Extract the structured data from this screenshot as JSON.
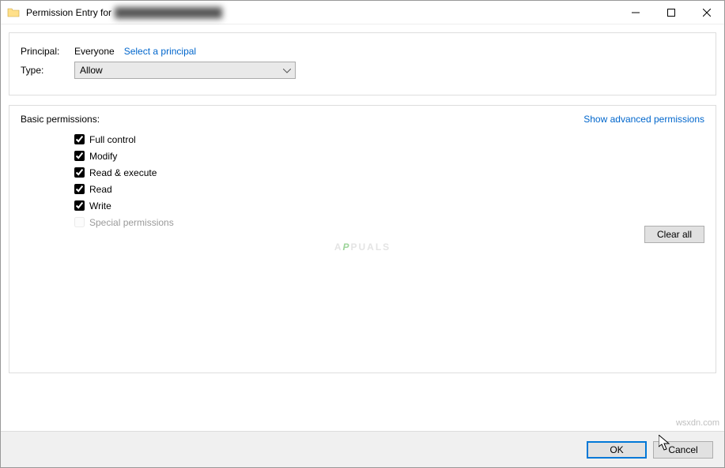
{
  "titlebar": {
    "title_prefix": "Permission Entry for",
    "title_obscured": "████████████████"
  },
  "principal": {
    "label": "Principal:",
    "value": "Everyone",
    "select_link": "Select a principal"
  },
  "type": {
    "label": "Type:",
    "selected": "Allow"
  },
  "permissions": {
    "heading": "Basic permissions:",
    "advanced_link": "Show advanced permissions",
    "items": [
      {
        "label": "Full control",
        "checked": true,
        "enabled": true
      },
      {
        "label": "Modify",
        "checked": true,
        "enabled": true
      },
      {
        "label": "Read & execute",
        "checked": true,
        "enabled": true
      },
      {
        "label": "Read",
        "checked": true,
        "enabled": true
      },
      {
        "label": "Write",
        "checked": true,
        "enabled": true
      },
      {
        "label": "Special permissions",
        "checked": false,
        "enabled": false
      }
    ],
    "clear_all": "Clear all"
  },
  "footer": {
    "ok": "OK",
    "cancel": "Cancel"
  },
  "watermark": {
    "pre": "A",
    "mid": "P",
    "post": "PUALS"
  },
  "corner_text": "wsxdn.com"
}
